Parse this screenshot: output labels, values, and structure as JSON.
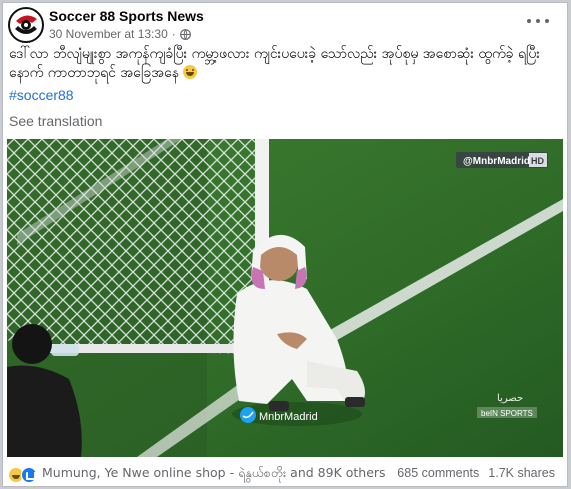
{
  "post": {
    "page_name": "Soccer 88 Sports News",
    "date": "30 November at 13:30",
    "separator": "·",
    "text": "ဒေါ်လာ ဘီလျံမျုးစွာ အကုန်ကျခံပြီး ကမ္ဘာ့ဖလား ကျင်းပပေးခဲ့ သော်လည်း အုပ်စုမှ အစောဆုံး ထွက်ခဲ့ ရပြီး နောက် ကာတာဘုရင် အခြေအနေ",
    "hashtag": "#soccer88",
    "see_translation": "See translation"
  },
  "photo": {
    "channel_logo": "@MnbrMadrid",
    "channel_badge": "HD",
    "twitter_watermark": "MnbrMadrid",
    "broadcaster_text": "حصريا",
    "broadcaster_sub": "beIN SPORTS"
  },
  "footer": {
    "reactors": "Mumung, Ye Nwe online shop - ရဲနွယ်စတိုး and 89K others",
    "comments": "685 comments",
    "shares": "1.7K shares"
  },
  "icons": {
    "avatar": "soccer-ball-logo",
    "privacy": "globe-icon",
    "more": "more-options-icon",
    "reactions": [
      "haha-icon",
      "like-icon"
    ]
  },
  "colors": {
    "link": "#216fdb",
    "muted": "#65676b",
    "pitch": "#2f6b2a"
  }
}
